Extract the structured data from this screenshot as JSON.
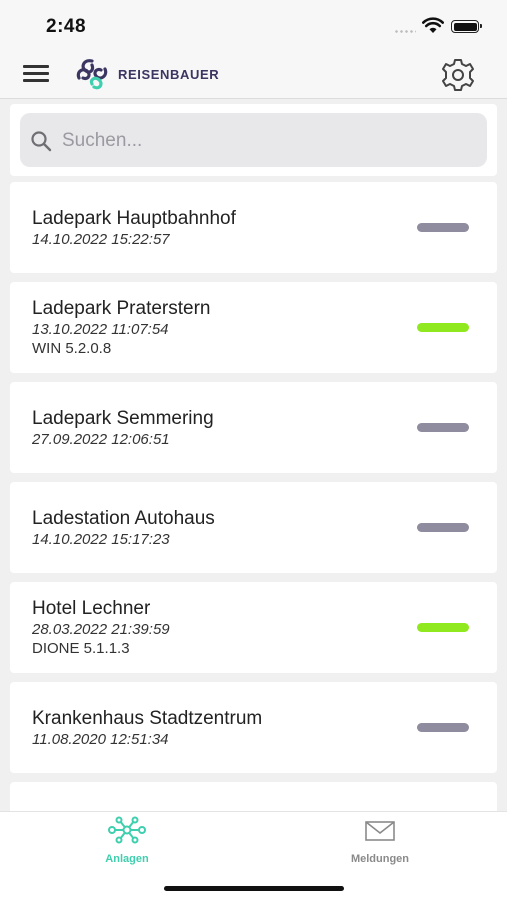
{
  "status_bar": {
    "time": "2:48"
  },
  "header": {
    "brand_name": "REISENBAUER",
    "menu_icon": "hamburger-icon",
    "settings_icon": "gear-icon"
  },
  "search": {
    "placeholder": "Suchen...",
    "value": ""
  },
  "colors": {
    "status_online": "#90e81e",
    "status_offline": "#8e8c9e",
    "tab_active": "#3ecfae",
    "tab_inactive": "#8a8a8a",
    "brand": "#3a3561"
  },
  "stations": [
    {
      "name": "Ladepark Hauptbahnhof",
      "date": "14.10.2022 15:22:57",
      "version": "",
      "status": "offline"
    },
    {
      "name": "Ladepark Praterstern",
      "date": "13.10.2022 11:07:54",
      "version": "WIN 5.2.0.8",
      "status": "online"
    },
    {
      "name": "Ladepark Semmering",
      "date": "27.09.2022 12:06:51",
      "version": "",
      "status": "offline"
    },
    {
      "name": "Ladestation Autohaus",
      "date": "14.10.2022 15:17:23",
      "version": "",
      "status": "offline"
    },
    {
      "name": "Hotel Lechner",
      "date": "28.03.2022 21:39:59",
      "version": "DIONE 5.1.1.3",
      "status": "online"
    },
    {
      "name": "Krankenhaus Stadtzentrum",
      "date": "11.08.2020 12:51:34",
      "version": "",
      "status": "offline"
    }
  ],
  "tabs": [
    {
      "label": "Anlagen",
      "icon": "network-icon",
      "active": true
    },
    {
      "label": "Meldungen",
      "icon": "mail-icon",
      "active": false
    }
  ]
}
